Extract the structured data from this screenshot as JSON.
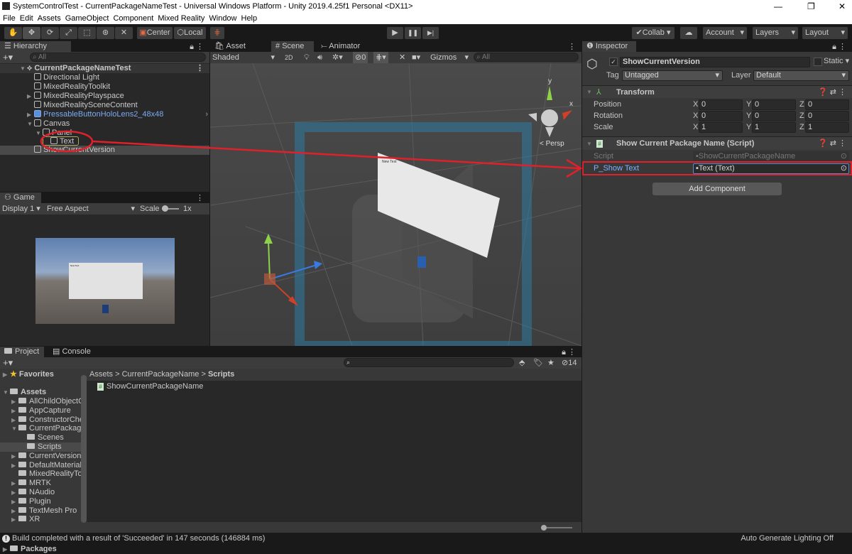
{
  "window": {
    "title": "SystemControlTest - CurrentPackageNameTest - Universal Windows Platform - Unity 2019.4.25f1 Personal <DX11>",
    "controls": [
      "—",
      "❐",
      "✕"
    ]
  },
  "menu": [
    "File",
    "Edit",
    "Assets",
    "GameObject",
    "Component",
    "Mixed Reality",
    "Window",
    "Help"
  ],
  "toolbar": {
    "tools": [
      "hand-tool",
      "move-tool",
      "rotate-tool",
      "scale-tool",
      "rect-tool",
      "transform-tool",
      "custom-tool"
    ],
    "center": "Center",
    "local": "Local",
    "play": "▶",
    "pause": "❚❚",
    "step": "▶|",
    "collab": "Collab",
    "account": "Account",
    "layers": "Layers",
    "layout": "Layout"
  },
  "hierarchy": {
    "tab": "Hierarchy",
    "search_placeholder": "All",
    "scene": "CurrentPackageNameTest",
    "items": [
      {
        "label": "Directional Light"
      },
      {
        "label": "MixedRealityToolkit"
      },
      {
        "label": "MixedRealityPlayspace"
      },
      {
        "label": "MixedRealitySceneContent"
      },
      {
        "label": "PressableButtonHoloLens2_48x48"
      },
      {
        "label": "Canvas"
      },
      {
        "label": "Panel"
      },
      {
        "label": "Text"
      },
      {
        "label": "ShowCurrentVersion"
      }
    ]
  },
  "game": {
    "tab": "Game",
    "display": "Display 1",
    "aspect": "Free Aspect",
    "scale_label": "Scale",
    "scale_value": "1x"
  },
  "scene": {
    "tabs": [
      "Asset Store",
      "Scene",
      "Animator"
    ],
    "shading": "Shaded",
    "mode_2d": "2D",
    "hidden_count": "0",
    "gizmos": "Gizmos",
    "search_placeholder": "All",
    "persp": "< Persp",
    "axis_y": "y",
    "axis_x": "x",
    "quad_text": "New Text"
  },
  "inspector": {
    "tab": "Inspector",
    "object_name": "ShowCurrentVersion",
    "active": true,
    "static": "Static",
    "tag_label": "Tag",
    "tag": "Untagged",
    "layer_label": "Layer",
    "layer": "Default",
    "transform": {
      "title": "Transform",
      "rows": [
        {
          "label": "Position",
          "x": "0",
          "y": "0",
          "z": "0"
        },
        {
          "label": "Rotation",
          "x": "0",
          "y": "0",
          "z": "0"
        },
        {
          "label": "Scale",
          "x": "1",
          "y": "1",
          "z": "1"
        }
      ]
    },
    "script": {
      "title": "Show Current Package Name (Script)",
      "script_label": "Script",
      "script_value": "ShowCurrentPackageName",
      "field_label": "P_Show Text",
      "field_value": "Text (Text)"
    },
    "add_component": "Add Component"
  },
  "project": {
    "tabs": [
      "Project",
      "Console"
    ],
    "favorites": "Favorites",
    "assets": "Assets",
    "folders": [
      {
        "label": "AllChildObjectC",
        "expand": "▶",
        "indent": 0
      },
      {
        "label": "AppCapture",
        "expand": "▶",
        "indent": 0
      },
      {
        "label": "ConstructorChe",
        "expand": "▶",
        "indent": 0
      },
      {
        "label": "CurrentPackage",
        "expand": "▼",
        "indent": 0
      },
      {
        "label": "Scenes",
        "expand": "",
        "indent": 1
      },
      {
        "label": "Scripts",
        "expand": "",
        "indent": 1
      },
      {
        "label": "CurrentVersion",
        "expand": "▶",
        "indent": 0
      },
      {
        "label": "DefaultMaterial",
        "expand": "▶",
        "indent": 0
      },
      {
        "label": "MixedRealityTo",
        "expand": "",
        "indent": 0
      },
      {
        "label": "MRTK",
        "expand": "▶",
        "indent": 0
      },
      {
        "label": "NAudio",
        "expand": "▶",
        "indent": 0
      },
      {
        "label": "Plugin",
        "expand": "▶",
        "indent": 0
      },
      {
        "label": "TextMesh Pro",
        "expand": "▶",
        "indent": 0
      },
      {
        "label": "XR",
        "expand": "▶",
        "indent": 0
      }
    ],
    "packages": "Packages",
    "breadcrumb": [
      "Assets",
      "CurrentPackageName",
      "Scripts"
    ],
    "files": [
      "ShowCurrentPackageName"
    ],
    "hidden_count": "14"
  },
  "status": {
    "message": "Build completed with a result of 'Succeeded' in 147 seconds (146884 ms)",
    "lighting": "Auto Generate Lighting Off"
  },
  "colors": {
    "annotation": "#e0202a",
    "accent": "#3a79bb",
    "prefab": "#7caaf0"
  }
}
